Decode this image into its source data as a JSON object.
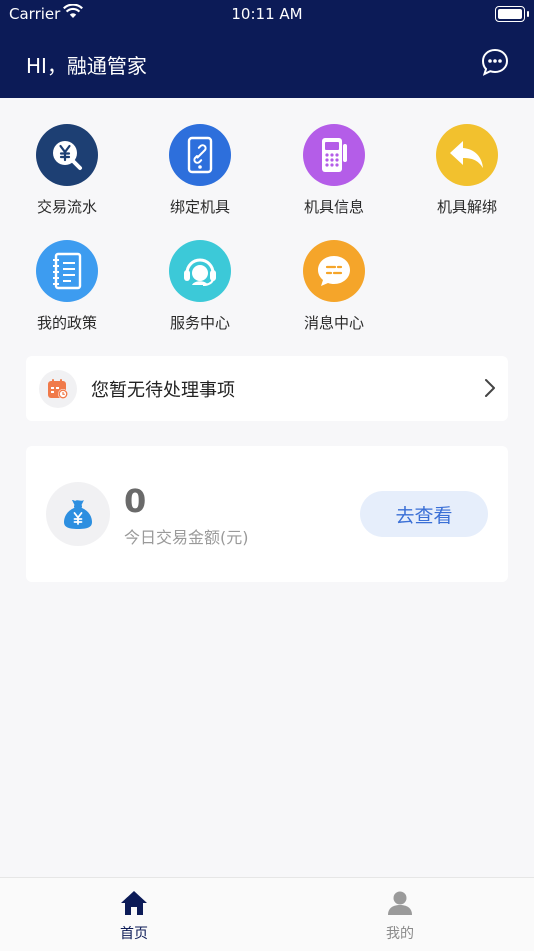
{
  "status": {
    "carrier": "Carrier",
    "time": "10:11 AM"
  },
  "header": {
    "greeting": "HI，融通管家",
    "message_icon": "chat-bubble-icon"
  },
  "menu": [
    {
      "label": "交易流水",
      "icon": "yen-search-icon",
      "color": "#1d3f73"
    },
    {
      "label": "绑定机具",
      "icon": "phone-link-icon",
      "color": "#2d6fdc"
    },
    {
      "label": "机具信息",
      "icon": "pos-terminal-icon",
      "color": "#b45de8"
    },
    {
      "label": "机具解绑",
      "icon": "undo-arrow-icon",
      "color": "#f2c12e"
    },
    {
      "label": "我的政策",
      "icon": "notebook-icon",
      "color": "#3d9cf0"
    },
    {
      "label": "服务中心",
      "icon": "headset-icon",
      "color": "#3cc9d8"
    },
    {
      "label": "消息中心",
      "icon": "chat-bubble-icon",
      "color": "#f5a52a"
    }
  ],
  "todo": {
    "text": "您暂无待处理事项",
    "icon": "calendar-icon"
  },
  "summary": {
    "amount": "0",
    "label": "今日交易金额(元)",
    "button": "去查看",
    "icon": "money-bag-icon"
  },
  "tabbar": {
    "items": [
      {
        "label": "首页",
        "active": true
      },
      {
        "label": "我的",
        "active": false
      }
    ]
  },
  "colors": {
    "header_bg": "#0c1b57",
    "accent": "#3a6fd6",
    "tab_active": "#0c1b57",
    "tab_inactive": "#8a8a8a"
  }
}
